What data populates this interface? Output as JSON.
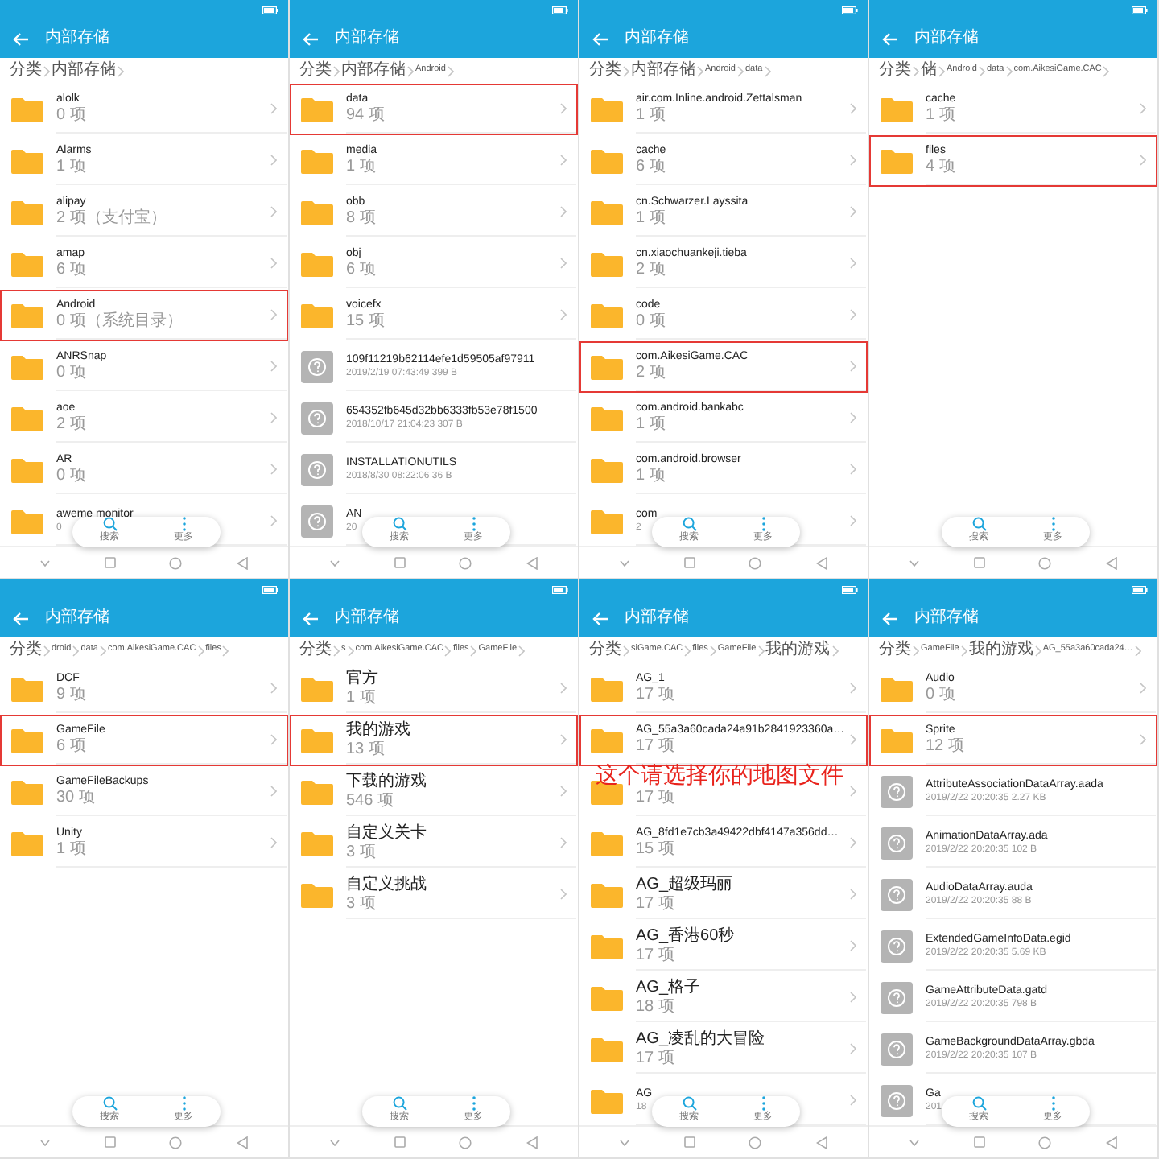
{
  "panels": [
    {
      "title": "内部存储",
      "breadcrumb": [
        "分类",
        "内部存储"
      ],
      "items": [
        {
          "kind": "folder",
          "name": "alolk",
          "detail": "0 项",
          "selected": false
        },
        {
          "kind": "folder",
          "name": "Alarms",
          "detail": "1 项",
          "selected": false
        },
        {
          "kind": "folder",
          "name": "alipay",
          "detail": "2 项（支付宝）",
          "selected": false
        },
        {
          "kind": "folder",
          "name": "amap",
          "detail": "6 项",
          "selected": false
        },
        {
          "kind": "folder",
          "name": "Android",
          "detail": "0 项（系统目录）",
          "selected": true
        },
        {
          "kind": "folder",
          "name": "ANRSnap",
          "detail": "0 项",
          "selected": false
        },
        {
          "kind": "folder",
          "name": "aoe",
          "detail": "2 项",
          "selected": false
        },
        {
          "kind": "folder",
          "name": "AR",
          "detail": "0 项",
          "selected": false
        },
        {
          "kind": "folder",
          "name": "aweme monitor",
          "detail": "0",
          "selected": false
        }
      ],
      "toolbar": [
        "搜索",
        "更多"
      ]
    },
    {
      "title": "内部存储",
      "breadcrumb": [
        "分类",
        "内部存储",
        "Android"
      ],
      "items": [
        {
          "kind": "folder",
          "name": "data",
          "detail": "94 项",
          "selected": true
        },
        {
          "kind": "folder",
          "name": "media",
          "detail": "1 项",
          "selected": false
        },
        {
          "kind": "folder",
          "name": "obb",
          "detail": "8 项",
          "selected": false
        },
        {
          "kind": "folder",
          "name": "obj",
          "detail": "6 项",
          "selected": false
        },
        {
          "kind": "folder",
          "name": "voicefx",
          "detail": "15 项",
          "selected": false
        },
        {
          "kind": "file",
          "name": "109f11219b62114efe1d59505af97911",
          "detail": "2019/2/19 07:43:49 399 B",
          "selected": false
        },
        {
          "kind": "file",
          "name": "654352fb645d32bb6333fb53e78f1500",
          "detail": "2018/10/17 21:04:23 307 B",
          "selected": false
        },
        {
          "kind": "file",
          "name": "INSTALLATIONUTILS",
          "detail": "2018/8/30 08:22:06 36 B",
          "selected": false
        },
        {
          "kind": "file",
          "name": "AN",
          "detail": "20",
          "selected": false
        }
      ],
      "toolbar": [
        "搜索",
        "更多"
      ]
    },
    {
      "title": "内部存储",
      "breadcrumb": [
        "分类",
        "内部存储",
        "Android",
        "data"
      ],
      "items": [
        {
          "kind": "folder",
          "name": "air.com.Inline.android.Zettalsman",
          "detail": "1 项",
          "selected": false
        },
        {
          "kind": "folder",
          "name": "cache",
          "detail": "6 项",
          "selected": false
        },
        {
          "kind": "folder",
          "name": "cn.Schwarzer.Layssita",
          "detail": "1 项",
          "selected": false
        },
        {
          "kind": "folder",
          "name": "cn.xiaochuankeji.tieba",
          "detail": "2 项",
          "selected": false
        },
        {
          "kind": "folder",
          "name": "code",
          "detail": "0 项",
          "selected": false
        },
        {
          "kind": "folder",
          "name": "com.AikesiGame.CAC",
          "detail": "2 项",
          "selected": true
        },
        {
          "kind": "folder",
          "name": "com.android.bankabc",
          "detail": "1 项",
          "selected": false
        },
        {
          "kind": "folder",
          "name": "com.android.browser",
          "detail": "1 项",
          "selected": false
        },
        {
          "kind": "folder",
          "name": "com",
          "detail": "2",
          "selected": false
        }
      ],
      "toolbar": [
        "搜索",
        "更多"
      ]
    },
    {
      "title": "内部存储",
      "breadcrumb": [
        "分类",
        "储",
        "Android",
        "data",
        "com.AikesiGame.CAC"
      ],
      "items": [
        {
          "kind": "folder",
          "name": "cache",
          "detail": "1 项",
          "selected": false
        },
        {
          "kind": "folder",
          "name": "files",
          "detail": "4 项",
          "selected": true
        }
      ],
      "toolbar": [
        "搜索",
        "更多"
      ]
    },
    {
      "title": "内部存储",
      "breadcrumb": [
        "分类",
        "droid",
        "data",
        "com.AikesiGame.CAC",
        "files"
      ],
      "items": [
        {
          "kind": "folder",
          "name": "DCF",
          "detail": "9 项",
          "selected": false
        },
        {
          "kind": "folder",
          "name": "GameFile",
          "detail": "6 项",
          "selected": true
        },
        {
          "kind": "folder",
          "name": "GameFileBackups",
          "detail": "30 项",
          "selected": false
        },
        {
          "kind": "folder",
          "name": "Unity",
          "detail": "1 项",
          "selected": false
        }
      ],
      "toolbar": [
        "搜索",
        "更多"
      ]
    },
    {
      "title": "内部存储",
      "breadcrumb": [
        "分类",
        "s",
        "com.AikesiGame.CAC",
        "files",
        "GameFile"
      ],
      "items": [
        {
          "kind": "folder",
          "name": "官方",
          "detail": "1 项",
          "selected": false
        },
        {
          "kind": "folder",
          "name": "我的游戏",
          "detail": "13 项",
          "selected": true
        },
        {
          "kind": "folder",
          "name": "下载的游戏",
          "detail": "546 项",
          "selected": false
        },
        {
          "kind": "folder",
          "name": "自定义关卡",
          "detail": "3 项",
          "selected": false
        },
        {
          "kind": "folder",
          "name": "自定义挑战",
          "detail": "3 项",
          "selected": false
        }
      ],
      "toolbar": [
        "搜索",
        "更多"
      ]
    },
    {
      "title": "内部存储",
      "breadcrumb": [
        "分类",
        "siGame.CAC",
        "files",
        "GameFile",
        "我的游戏"
      ],
      "items": [
        {
          "kind": "folder",
          "name": "AG_1",
          "detail": "17 项",
          "selected": false
        },
        {
          "kind": "folder",
          "name": "AG_55a3a60cada24a91b2841923360a…",
          "detail": "17 项",
          "selected": true
        },
        {
          "kind": "folder",
          "detail": "17 项",
          "selected": false
        },
        {
          "kind": "folder",
          "name": "AG_8fd1e7cb3a49422dbf4147a356dd…",
          "detail": "15 项",
          "selected": false
        },
        {
          "kind": "folder",
          "name": "AG_超级玛丽",
          "detail": "17 项",
          "selected": false
        },
        {
          "kind": "folder",
          "name": "AG_香港60秒",
          "detail": "17 项",
          "selected": false
        },
        {
          "kind": "folder",
          "name": "AG_格子",
          "detail": "18 项",
          "selected": false
        },
        {
          "kind": "folder",
          "name": "AG_凌乱的大冒险",
          "detail": "17 项",
          "selected": false
        },
        {
          "kind": "folder",
          "name": "AG",
          "detail": "18",
          "selected": false
        }
      ],
      "annotation": "这个请选择你的地图文件",
      "toolbar": [
        "搜索",
        "更多"
      ]
    },
    {
      "title": "内部存储",
      "breadcrumb": [
        "分类",
        "GameFile",
        "我的游戏",
        "AG_55a3a60cada24…"
      ],
      "items": [
        {
          "kind": "folder",
          "name": "Audio",
          "detail": "0 项",
          "selected": false
        },
        {
          "kind": "folder",
          "name": "Sprite",
          "detail": "12 项",
          "selected": true
        },
        {
          "kind": "file",
          "name": "AttributeAssociationDataArray.aada",
          "detail": "2019/2/22 20:20:35 2.27 KB",
          "selected": false
        },
        {
          "kind": "file",
          "name": "AnimationDataArray.ada",
          "detail": "2019/2/22 20:20:35 102 B",
          "selected": false
        },
        {
          "kind": "file",
          "name": "AudioDataArray.auda",
          "detail": "2019/2/22 20:20:35 88 B",
          "selected": false
        },
        {
          "kind": "file",
          "name": "ExtendedGameInfoData.egid",
          "detail": "2019/2/22 20:20:35 5.69 KB",
          "selected": false
        },
        {
          "kind": "file",
          "name": "GameAttributeData.gatd",
          "detail": "2019/2/22 20:20:35 798 B",
          "selected": false
        },
        {
          "kind": "file",
          "name": "GameBackgroundDataArray.gbda",
          "detail": "2019/2/22 20:20:35 107 B",
          "selected": false
        },
        {
          "kind": "file",
          "name": "Ga",
          "detail": "201",
          "selected": false
        }
      ],
      "toolbar": [
        "搜索",
        "更多"
      ]
    }
  ]
}
